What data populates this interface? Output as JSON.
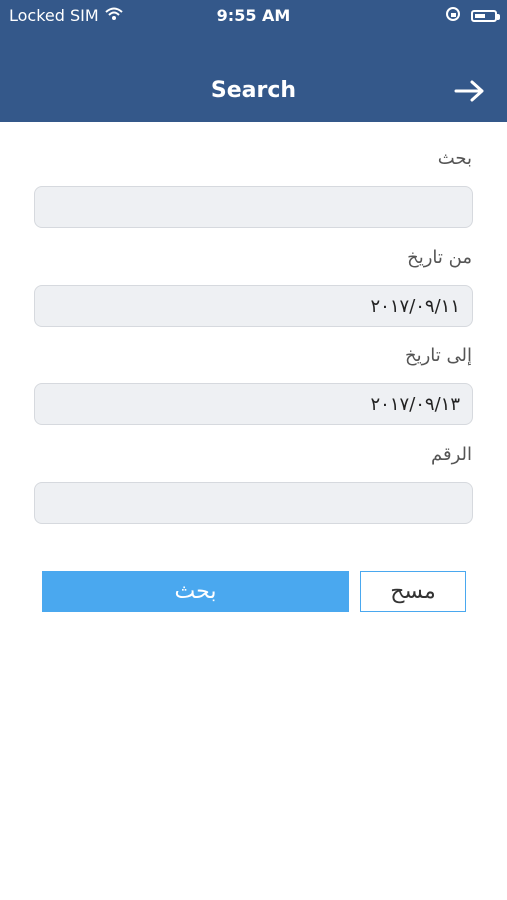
{
  "status": {
    "carrier": "Locked SIM",
    "time": "9:55 AM"
  },
  "header": {
    "title": "Search"
  },
  "form": {
    "search_label": "بحث",
    "search_value": "",
    "from_date_label": "من تاريخ",
    "from_date_value": "٢٠١٧/٠٩/١١",
    "to_date_label": "إلى تاريخ",
    "to_date_value": "٢٠١٧/٠٩/١٣",
    "number_label": "الرقم",
    "number_value": ""
  },
  "buttons": {
    "search_label": "بحث",
    "clear_label": "مسح"
  },
  "colors": {
    "header_bg": "#34588a",
    "primary": "#4aa8ef"
  }
}
